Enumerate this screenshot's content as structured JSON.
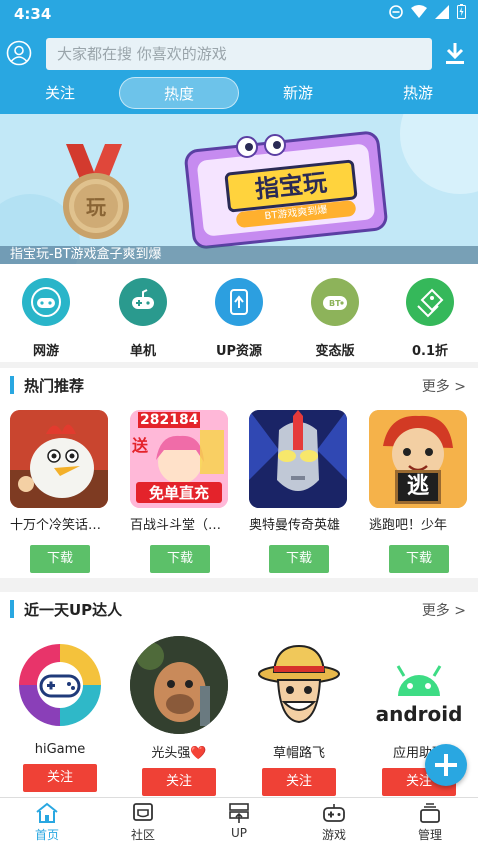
{
  "status_bar": {
    "time": "4:34"
  },
  "header": {
    "search_placeholder": "大家都在搜  你喜欢的游戏",
    "tabs": [
      {
        "label": "关注",
        "active": false
      },
      {
        "label": "热度",
        "active": true
      },
      {
        "label": "新游",
        "active": false
      },
      {
        "label": "热游",
        "active": false
      }
    ]
  },
  "banner": {
    "caption": "指宝玩-BT游戏盒子爽到爆",
    "sign_text": "指宝玩",
    "sign_subtext": "BT游戏爽到爆",
    "medal_text": "玩"
  },
  "categories": [
    {
      "label": "网游",
      "color": "#29b5c9"
    },
    {
      "label": "单机",
      "color": "#2a9a8e"
    },
    {
      "label": "UP资源",
      "color": "#2c9fe0"
    },
    {
      "label": "变态版",
      "color": "#8db35a"
    },
    {
      "label": "0.1折",
      "color": "#35b85a"
    }
  ],
  "hot": {
    "title": "热门推荐",
    "more": "更多 >",
    "games": [
      {
        "name": "十万个冷笑话…",
        "button": "下载",
        "icon": "cartoon-chicken-icon"
      },
      {
        "name": "百战斗斗堂（…",
        "button": "下载",
        "icon": "anime-girl-icon",
        "overlay_top": "282184",
        "overlay_bottom": "免单直充",
        "overlay_left": "送"
      },
      {
        "name": "奥特曼传奇英雄",
        "button": "下载",
        "icon": "ultraman-icon"
      },
      {
        "name": "逃跑吧！少年",
        "button": "下载",
        "icon": "cartoon-boy-icon",
        "overlay_sign": "逃"
      }
    ]
  },
  "up": {
    "title": "近一天UP达人",
    "more": "更多 >",
    "users": [
      {
        "name": "hiGame",
        "button": "关注",
        "icon": "gamepad-logo-icon"
      },
      {
        "name": "光头强❤️",
        "button": "关注",
        "icon": "bear-character-icon"
      },
      {
        "name": "草帽路飞",
        "button": "关注",
        "icon": "straw-hat-icon"
      },
      {
        "name": "应用助理",
        "button": "关注",
        "icon": "android-icon",
        "logo_text": "android"
      }
    ]
  },
  "bottom_nav": [
    {
      "label": "首页",
      "active": true
    },
    {
      "label": "社区",
      "active": false
    },
    {
      "label": "UP",
      "active": false
    },
    {
      "label": "游戏",
      "active": false
    },
    {
      "label": "管理",
      "active": false
    }
  ],
  "colors": {
    "primary": "#29a7e1",
    "download": "#5cc069",
    "follow": "#ef4136"
  }
}
